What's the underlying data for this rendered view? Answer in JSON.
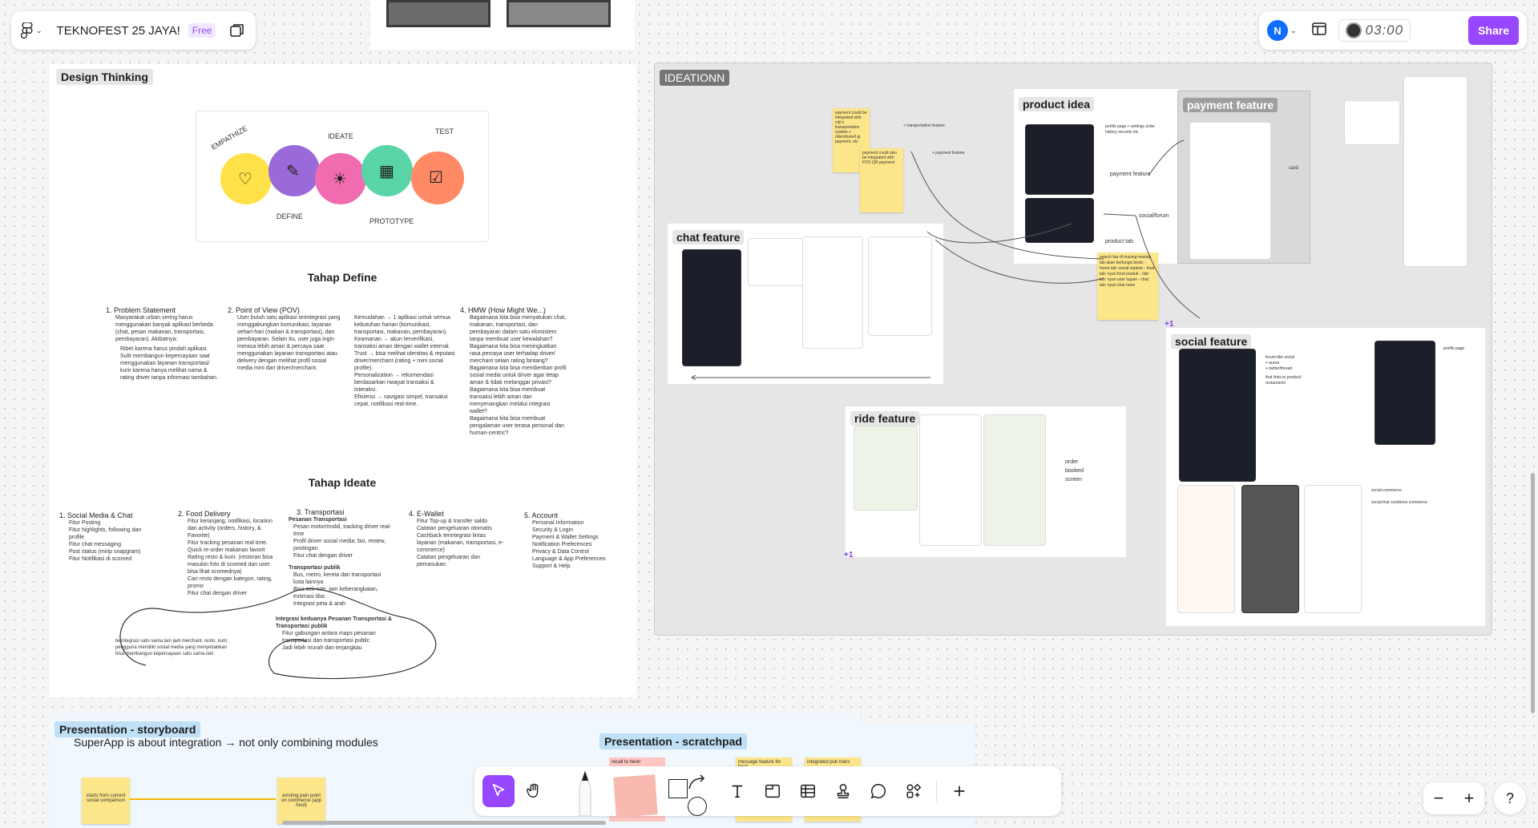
{
  "app": {
    "file_name": "TEKNOFEST 25 JAYA!",
    "plan_badge": "Free",
    "avatar_initial": "N",
    "timer": "03:00",
    "share_label": "Share",
    "accent": "#9747ff"
  },
  "board": {
    "design_thinking": {
      "label": "Design Thinking",
      "stages": [
        "EMPATHIZE",
        "DEFINE",
        "IDEATE",
        "PROTOTYPE",
        "TEST"
      ],
      "define": {
        "title": "Tahap Define",
        "col1_title": "1. Problem Statement",
        "col1_body": "Masyarakat urban sering harus menggunakan banyak aplikasi berbeda (chat, pesan makanan, transportasi, pembayaran). Akibatnya:",
        "col1_bullets": [
          "Ribet karena harus pindah aplikasi.",
          "Sulit membangun kepercayaan saat menggunakan layanan transportasi/ kurir karena hanya melihat nama & rating driver tanpa informasi tambahan."
        ],
        "col2_title": "2. Point of View (POV)",
        "col2_body": "User butuh satu aplikasi terintegrasi yang menggabungkan komunikasi, layanan sehari-hari (makan & transportasi), dan pembayaran. Selain itu, user juga ingin merasa lebih aman & percaya saat menggunakan layanan transportasi atau delivery dengan melihat profil sosial media mini dari driver/merchant.",
        "col3_items": [
          "Kemudahan → 1 aplikasi untuk semua kebutuhan harian (komunikasi, transportasi, makanan, pembayaran).",
          "Keamanan → akun terverifikasi, transaksi aman dengan wallet internal.",
          "Trust → bisa melihat identitas & reputasi driver/merchant (rating + mini social profile).",
          "Personalization → rekomendasi berdasarkan riwayat transaksi & interaksi.",
          "Efisiensi → navigasi simpel, transaksi cepat, notifikasi real-time."
        ],
        "col4_title": "4. HMW (How Might We...)",
        "col4_items": [
          "Bagaimana kita bisa menyatukan chat, makanan, transportasi, dan pembayaran dalam satu ekosistem tanpa membuat user kewalahan?",
          "Bagaimana kita bisa meningkatkan rasa percaya user terhadap driver/ merchant selain rating bintang?",
          "Bagaimana kita bisa memberikan profil sosial media untuk driver agar tetap aman & tidak melanggar privasi?",
          "Bagaimana kita bisa membuat transaksi lebih aman dan menyenangkan melalui integrasi wallet?",
          "Bagaimana kita bisa membuat pengalaman user terasa personal dan human-centric?"
        ]
      },
      "ideate": {
        "title": "Tahap Ideate",
        "cols": [
          {
            "title": "1. Social Media & Chat",
            "items": [
              "Fitur Posting",
              "Fitur highlights, following dan profile",
              "Fitur chat messaging",
              "Post status (mirip snapgram)",
              "Fitur Notifikasi di scomed"
            ]
          },
          {
            "title": "2. Food Delivery",
            "items": [
              "Fitur keranjang, notifikasi, location dan activity (orders, history, & Favorite)",
              "Fitur tracking pesanan real time.",
              "Quick re-order makanan favorit",
              "Rating resto & kurir. (restoran bisa masukin foto di scomed dan user bisa lihat scomednya)",
              "Cari resto dengan kategori, rating, promo",
              "Fitur chat dengan driver"
            ]
          },
          {
            "title": "3. Transportasi",
            "items": [
              "Pesanan Transportasi",
              "Pesan motor/mobil, tracking driver real-time",
              "Profil driver social media: bio, review, postingan",
              "Fitur chat dengan driver",
              "Transportasi publik",
              "Bus, metro, kereta dan transportasi kota lainnya",
              "Bisa cek rute, jam keberangkatan, estimasi tiba",
              "Integrasi peta & arah"
            ]
          },
          {
            "title": "4. E-Wallet",
            "items": [
              "Fitur Top-up & transfer saldo",
              "Catatan pengeluaran otomatis",
              "Cashback terintegrasi lintas layanan (makanan, transportasi, e-commerce)",
              "Catatan pengeluaran dan pemasukan"
            ]
          },
          {
            "title": "5. Account",
            "items": [
              "Personal Information",
              "Security & Login",
              "Payment & Wallet Settings",
              "Notification Preferences",
              "Privacy & Data Control",
              "Language & App Preferences",
              "Support & Help"
            ]
          }
        ],
        "integration_title": "Integrasi keduanya Pesanan Transportasi & Transportasi publik",
        "integration_items": [
          "Fitur gabungan antara maps pesanan transportasi dan transportasi public",
          "Jadi lebih murah dan terjangkau"
        ],
        "side_note": "terintegrasi satu sama lain jadi merchant, resto, kurir, pengguna memiliki sosial media yang menyebabkan bisa membangun kepercayaan satu sama lain"
      }
    },
    "ideation": {
      "label": "IDEATIONN",
      "chat_feature": "chat feature",
      "product_idea": "product idea",
      "payment_feature": "payment feature",
      "social_feature": "social feature",
      "ride_feature": "ride feature",
      "sticky1": "payment could be integrated with city's transportation system + ridershuke/t gr payment, etc",
      "sticky2": "payment could also be integrated with POS QR payment",
      "annot_transport": "+ transportation feature",
      "annot_payment": "+ payment feature",
      "annot_profile": "profile page + settings order history security etc",
      "annot_payment2": "payment feature",
      "annot_social_forum": "social/forum",
      "annot_product_tab": "product tab",
      "annot_card": "card",
      "search_sticky": "search bar di masing-masing tab akan berfungsi beda: - home tab: social explore - food tab: nyari food produk - ride tab: nyari rute/ tujuan - chat tab: nyari chat room",
      "ride_note": "order booked screen",
      "social_notes": [
        "forum-like social",
        "+ quora",
        "+ twitter/thread",
        "that links to product/ restaurants"
      ],
      "profile_note": "profile page",
      "commerce_notes": [
        "social-commerce",
        "social that combines commerce"
      ],
      "plus_one": "+1"
    },
    "storyboard": {
      "label": "Presentation - storyboard",
      "subtitle": "SuperApp is about integration → not only combining modules",
      "box1": "starts from current social comparison",
      "box2": "existing pain point on commerce (app food)"
    },
    "scratchpad": {
      "label": "Presentation - scratchpad",
      "notes": [
        "recall to here!",
        "message feature for food",
        "integrated pub trans"
      ]
    }
  },
  "toolbar": {
    "tools": [
      "move",
      "hand",
      "pen",
      "sticky",
      "shape",
      "connector",
      "text",
      "section",
      "table",
      "stamp",
      "comment",
      "more",
      "add"
    ]
  },
  "zoom": {
    "out": "−",
    "in": "+",
    "help": "?"
  }
}
